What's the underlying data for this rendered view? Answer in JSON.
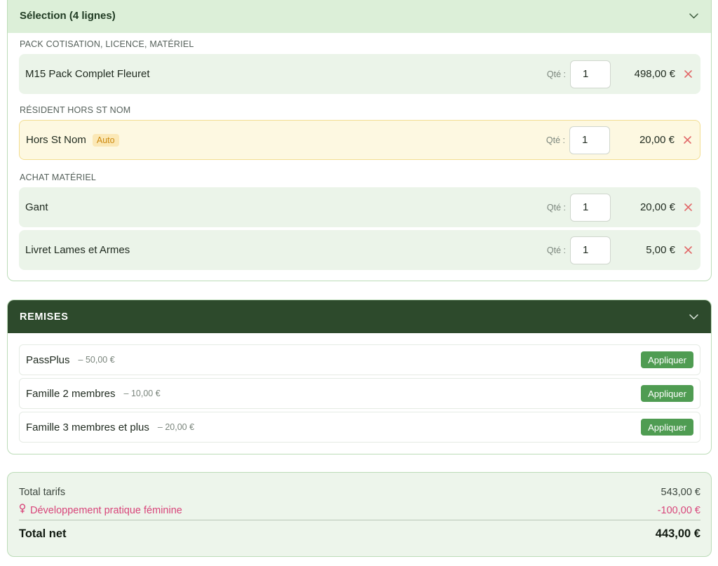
{
  "selection": {
    "title": "Sélection (4 lignes)",
    "qty_label": "Qté :",
    "sections": [
      {
        "label": "PACK COTISATION, LICENCE, MATÉRIEL",
        "items": [
          {
            "name": "M15 Pack Complet Fleuret",
            "qty": "1",
            "price": "498,00 €",
            "auto": false
          }
        ]
      },
      {
        "label": "RÉSIDENT HORS ST NOM",
        "items": [
          {
            "name": "Hors St Nom",
            "badge": "Auto",
            "qty": "1",
            "price": "20,00 €",
            "auto": true
          }
        ]
      },
      {
        "label": "ACHAT MATÉRIEL",
        "items": [
          {
            "name": "Gant",
            "qty": "1",
            "price": "20,00 €",
            "auto": false
          },
          {
            "name": "Livret Lames et Armes",
            "qty": "1",
            "price": "5,00 €",
            "auto": false
          }
        ]
      }
    ]
  },
  "remises": {
    "title": "REMISES",
    "apply_label": "Appliquer",
    "items": [
      {
        "name": "PassPlus",
        "amount": "– 50,00 €"
      },
      {
        "name": "Famille 2 membres",
        "amount": "– 10,00 €"
      },
      {
        "name": "Famille 3 membres et plus",
        "amount": "– 20,00 €"
      }
    ]
  },
  "totals": {
    "total_tarifs_label": "Total tarifs",
    "total_tarifs_value": "543,00 €",
    "feminine_label": "Développement pratique féminine",
    "feminine_value": "-100,00 €",
    "net_label": "Total net",
    "net_value": "443,00 €"
  },
  "colors": {
    "accent_green": "#4f9c52",
    "dark_green": "#2d4a2c",
    "light_green": "#dcefd8",
    "feminine_pink": "#d8457a",
    "remove_red": "#e26a6a"
  },
  "icons": {
    "collapse": "chevron-down-icon",
    "remove": "close-icon",
    "feminine": "female-symbol-icon"
  }
}
